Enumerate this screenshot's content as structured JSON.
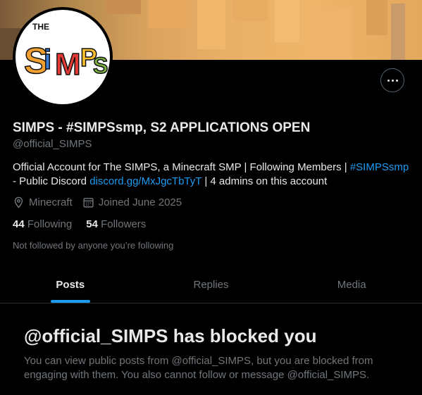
{
  "profile": {
    "name": "SIMPS - #SIMPSsmp, S2 APPLICATIONS OPEN",
    "handle": "@official_SIMPS",
    "avatar_text": "SIMPS",
    "avatar_small_text": "THE",
    "bio_part1": "Official Account for The SIMPS, a Minecraft SMP | Following Members | ",
    "bio_hashtag": "#SIMPSsmp",
    "bio_part2": " - Public Discord ",
    "bio_link": "discord.gg/MxJgcTbTyT",
    "bio_part3": " | 4 admins on this account",
    "location": "Minecraft",
    "joined": "Joined June 2025",
    "following_count": "44",
    "following_label": "Following",
    "followers_count": "54",
    "followers_label": "Followers",
    "not_followed": "Not followed by anyone you’re following"
  },
  "tabs": [
    {
      "label": "Posts",
      "active": true
    },
    {
      "label": "Replies",
      "active": false
    },
    {
      "label": "Media",
      "active": false
    }
  ],
  "blocked": {
    "title": "@official_SIMPS has blocked you",
    "text": "You can view public posts from @official_SIMPS, but you are blocked from engaging with them. You also cannot follow or message @official_SIMPS."
  },
  "icons": {
    "more": "more-options-icon",
    "location": "location-pin-icon",
    "calendar": "calendar-icon"
  },
  "colors": {
    "background": "#000000",
    "text": "#e7e9ea",
    "secondary": "#71767b",
    "accent": "#1d9bf0",
    "border": "#2f3336"
  }
}
